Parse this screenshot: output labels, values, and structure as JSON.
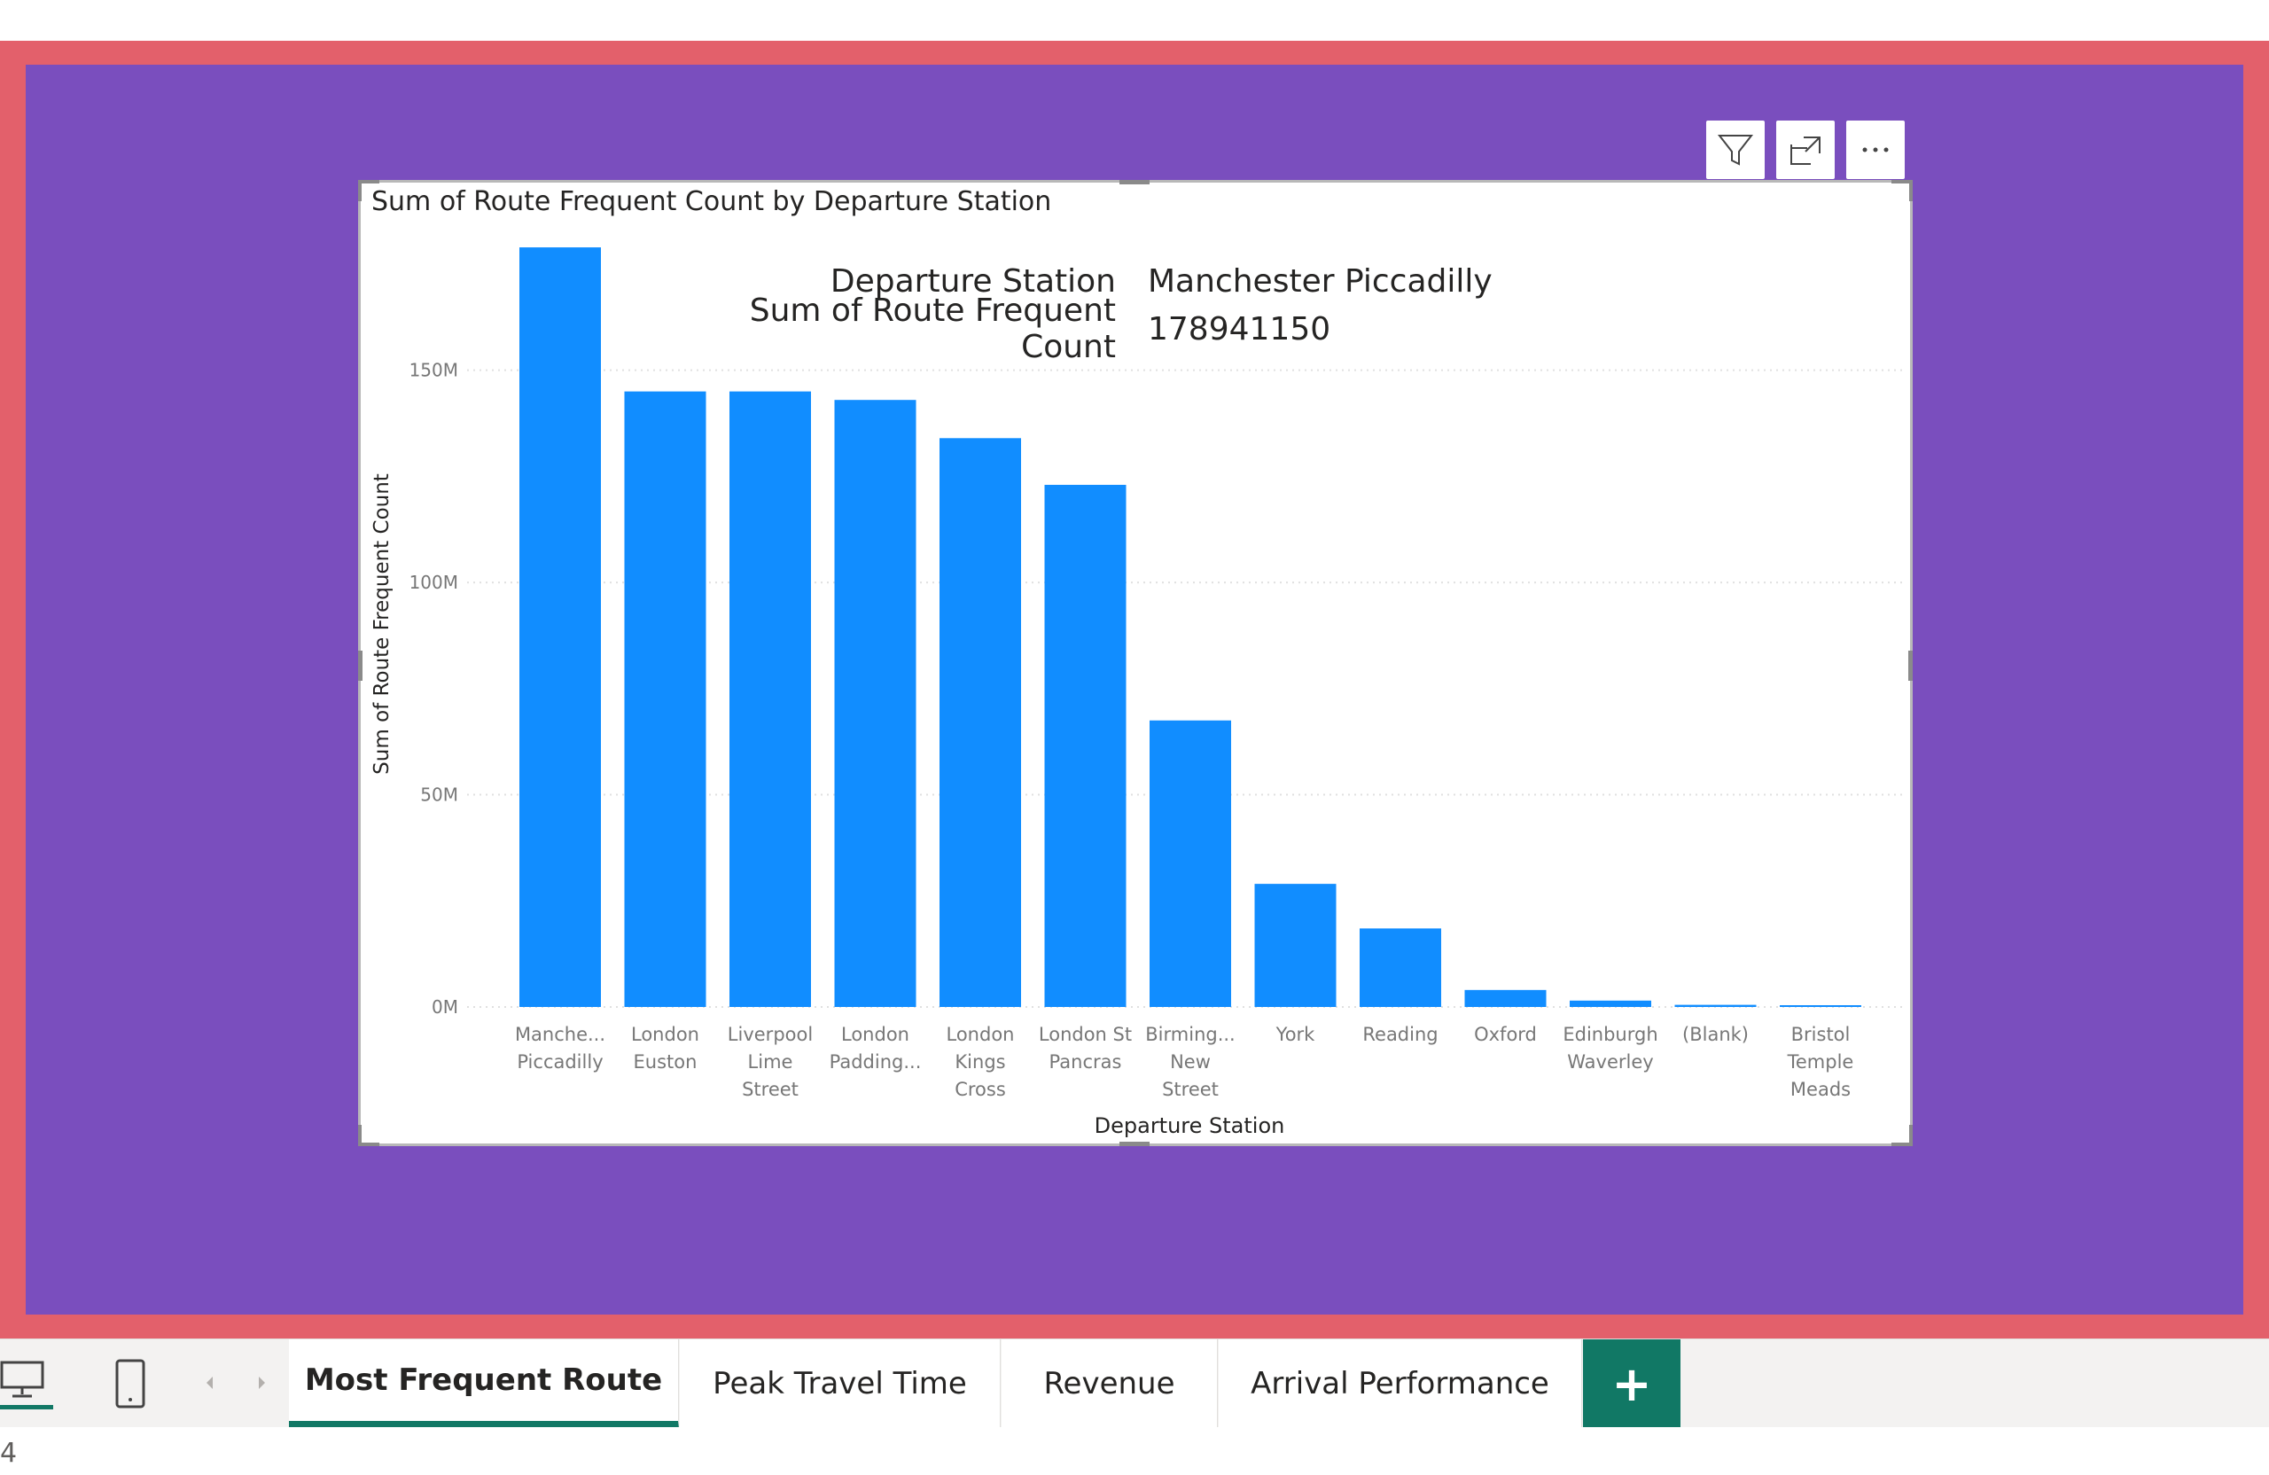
{
  "visual_header": {
    "filter_icon": "filter-icon",
    "focus_icon": "focus-mode-icon",
    "more_icon": "more-options-icon"
  },
  "chart_data": {
    "type": "bar",
    "title": "Sum of Route Frequent Count by Departure Station",
    "xlabel": "Departure Station",
    "ylabel": "Sum of Route Frequent Count",
    "ylim": [
      0,
      180000000
    ],
    "yticks": [
      0,
      50000000,
      100000000,
      150000000
    ],
    "ytick_labels": [
      "0M",
      "50M",
      "100M",
      "150M"
    ],
    "grid": true,
    "color": "#118dff",
    "categories": [
      [
        "Manche...",
        "Piccadilly"
      ],
      [
        "London",
        "Euston"
      ],
      [
        "Liverpool",
        "Lime",
        "Street"
      ],
      [
        "London",
        "Padding..."
      ],
      [
        "London",
        "Kings",
        "Cross"
      ],
      [
        "London St",
        "Pancras"
      ],
      [
        "Birming...",
        "New",
        "Street"
      ],
      [
        "York"
      ],
      [
        "Reading"
      ],
      [
        "Oxford"
      ],
      [
        "Edinburgh",
        "Waverley"
      ],
      [
        "(Blank)"
      ],
      [
        "Bristol",
        "Temple",
        "Meads"
      ]
    ],
    "values": [
      178941150,
      145000000,
      145000000,
      143000000,
      134000000,
      123000000,
      67500000,
      29000000,
      18500000,
      4000000,
      1500000,
      500000,
      400000
    ],
    "extra_overlay_note": null
  },
  "tooltip": {
    "rows": [
      {
        "key": "Departure Station",
        "value": "Manchester Piccadilly"
      },
      {
        "key": "Sum of Route Frequent Count",
        "value": "178941150"
      }
    ]
  },
  "bottom_bar": {
    "desktop_icon": "desktop-icon",
    "mobile_icon": "mobile-icon",
    "tabs": [
      {
        "label": "Most Frequent Route",
        "active": true
      },
      {
        "label": "Peak Travel Time",
        "active": false
      },
      {
        "label": "Revenue",
        "active": false
      },
      {
        "label": "Arrival Performance",
        "active": false
      }
    ],
    "add_label": "+"
  },
  "status": {
    "page_count": "4"
  }
}
